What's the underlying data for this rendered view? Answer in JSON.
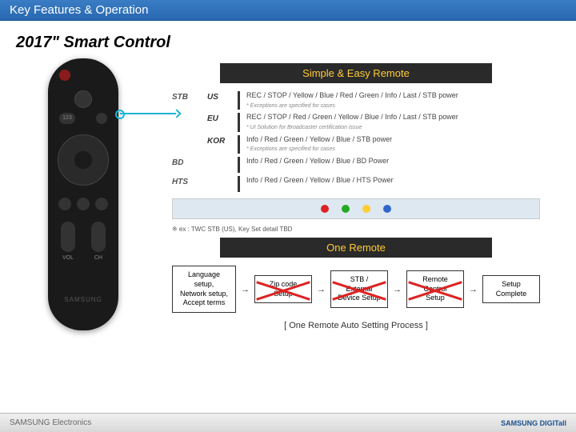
{
  "header": "Key Features & Operation",
  "subtitle": "2017\" Smart Control",
  "remote": {
    "num": "123",
    "vol": "VOL",
    "ch": "CH",
    "brand": "SAMSUNG"
  },
  "banner1": "Simple & Easy Remote",
  "rows": [
    {
      "cat": "STB",
      "region": "US",
      "desc": "REC / STOP / Yellow / Blue / Red / Green / Info / Last / STB power",
      "sub": "* Exceptions are specified for cases"
    },
    {
      "cat": "",
      "region": "EU",
      "desc": "REC / STOP / Red / Green / Yellow / Blue / Info / Last / STB power",
      "sub": "* UI Solution for Broadcaster certification issue"
    },
    {
      "cat": "",
      "region": "KOR",
      "desc": "Info / Red / Green / Yellow / Blue / STB power",
      "sub": "* Exceptions are specified for cases"
    },
    {
      "cat": "BD",
      "region": "",
      "desc": "Info / Red / Green / Yellow / Blue / BD Power",
      "sub": ""
    },
    {
      "cat": "HTS",
      "region": "",
      "desc": "Info / Red / Green / Yellow / Blue / HTS Power",
      "sub": ""
    }
  ],
  "note": "※ ex : TWC STB (US), Key Set detail TBD",
  "banner2": "One Remote",
  "flow": [
    {
      "text": "Language setup,\nNetwork setup,\nAccept terms",
      "x": false
    },
    {
      "text": "Zip code\nSetup",
      "x": true
    },
    {
      "text": "STB / External\nDevice Setup",
      "x": true
    },
    {
      "text": "Remote\nControl\nSetup",
      "x": true
    },
    {
      "text": "Setup\nComplete",
      "x": false
    }
  ],
  "caption": "[ One Remote Auto Setting Process ]",
  "footer": {
    "left": "SAMSUNG Electronics",
    "right": "SAMSUNG DIGITall"
  }
}
